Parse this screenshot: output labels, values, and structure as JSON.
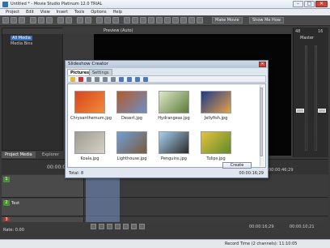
{
  "window": {
    "title": "Untitled * - Movie Studio Platinum 12.0 TRIAL",
    "controls": {
      "minimize": "–",
      "maximize": "□",
      "close": "✕"
    }
  },
  "menu": [
    "Project",
    "Edit",
    "View",
    "Insert",
    "Tools",
    "Options",
    "Help"
  ],
  "toolbar": {
    "make_movie": "Make Movie",
    "show_me_how": "Show Me How"
  },
  "preview": {
    "mode": "Preview (Auto)"
  },
  "media": {
    "tree": [
      "All Media",
      "Media Bins"
    ],
    "tabs": [
      "Project Media",
      "Explorer"
    ]
  },
  "master": {
    "label": "Master",
    "left_value": "48",
    "right_value": "16"
  },
  "dialog": {
    "title": "Slideshow Creator",
    "tabs": [
      "Pictures",
      "Settings"
    ],
    "pictures": [
      {
        "name": "Chrysanthemum.jpg",
        "colors": [
          "#d9461f",
          "#f28a3a"
        ]
      },
      {
        "name": "Desert.jpg",
        "colors": [
          "#b45a2b",
          "#6c8fc4"
        ]
      },
      {
        "name": "Hydrangeas.jpg",
        "colors": [
          "#dfe8c8",
          "#5b7b3a"
        ]
      },
      {
        "name": "Jellyfish.jpg",
        "colors": [
          "#1b3c8c",
          "#e79f45"
        ]
      },
      {
        "name": "Koala.jpg",
        "colors": [
          "#9c9b93",
          "#d7d1c5"
        ]
      },
      {
        "name": "Lighthouse.jpg",
        "colors": [
          "#6fa0d8",
          "#7a5a3a"
        ]
      },
      {
        "name": "Penguins.jpg",
        "colors": [
          "#a7d0f0",
          "#2a2a2a"
        ]
      },
      {
        "name": "Tulips.jpg",
        "colors": [
          "#e8c23a",
          "#5e8b2c"
        ]
      }
    ],
    "total_label": "Total: 8",
    "total_time": "00:00:16;29",
    "create_label": "Create"
  },
  "timeline": {
    "tracks": [
      {
        "num": "1",
        "color": "green",
        "name": ""
      },
      {
        "num": "2",
        "color": "green",
        "name": "Text"
      },
      {
        "num": "3",
        "color": "red",
        "name": ""
      }
    ],
    "timecodes": [
      "00:00:00",
      "00:00:44;29",
      "00:00:46;29"
    ],
    "cursor_time": "00:00:16;29",
    "end_time": "00:00:10;21"
  },
  "rate": {
    "label": "Rate: 0.00"
  },
  "status": {
    "record_time": "Record Time (2 channels): 11:10:05"
  }
}
